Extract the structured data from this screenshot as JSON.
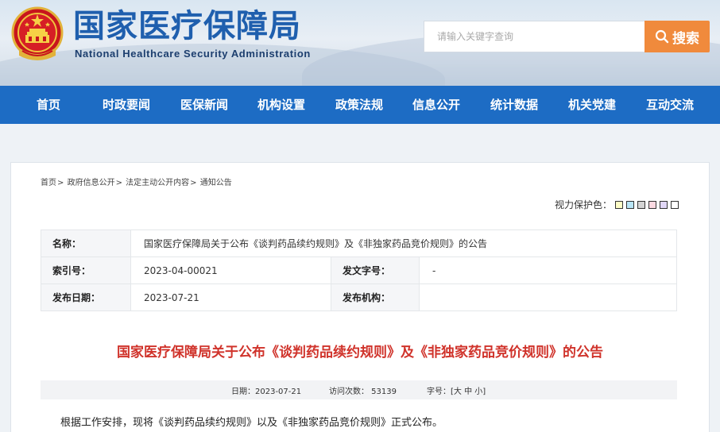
{
  "header": {
    "title": "国家医疗保障局",
    "subtitle": "National Healthcare Security Administration",
    "emblem_icon": "national-emblem-icon"
  },
  "search": {
    "placeholder": "请输入关键字查询",
    "button_label": "搜索",
    "button_color": "#f08a3c"
  },
  "nav": {
    "bg_color": "#1d6cc4",
    "items": [
      {
        "label": "首页"
      },
      {
        "label": "时政要闻"
      },
      {
        "label": "医保新闻"
      },
      {
        "label": "机构设置"
      },
      {
        "label": "政策法规"
      },
      {
        "label": "信息公开"
      },
      {
        "label": "统计数据"
      },
      {
        "label": "机关党建"
      },
      {
        "label": "互动交流"
      }
    ]
  },
  "breadcrumb": {
    "items": [
      "首页",
      "政府信息公开",
      "法定主动公开内容",
      "通知公告"
    ],
    "separator": ">"
  },
  "eye_protect": {
    "label": "视力保护色：",
    "swatches": [
      "#fefdc6",
      "#b9e5f6",
      "#d4d4d4",
      "#fbd9e1",
      "#e1d7f7",
      "#ffffff"
    ]
  },
  "info": {
    "name_label": "名称：",
    "name_value": "国家医疗保障局关于公布《谈判药品续约规则》及《非独家药品竞价规则》的公告",
    "index_label": "索引号：",
    "index_value": "2023-04-00021",
    "doc_no_label": "发文字号：",
    "doc_no_value": "-",
    "date_label": "发布日期：",
    "date_value": "2023-07-21",
    "org_label": "发布机构：",
    "org_value": ""
  },
  "article": {
    "title": "国家医疗保障局关于公布《谈判药品续约规则》及《非独家药品竞价规则》的公告",
    "title_color": "#d0332b",
    "date_text": "日期：2023-07-21",
    "visits_text": "访问次数： 53139",
    "font_size_label": "字号：[",
    "font_large": "大",
    "font_medium": "中",
    "font_small": "小",
    "font_close": "]",
    "body_first": "根据工作安排，现将《谈判药品续约规则》以及《非独家药品竞价规则》正式公布。"
  }
}
